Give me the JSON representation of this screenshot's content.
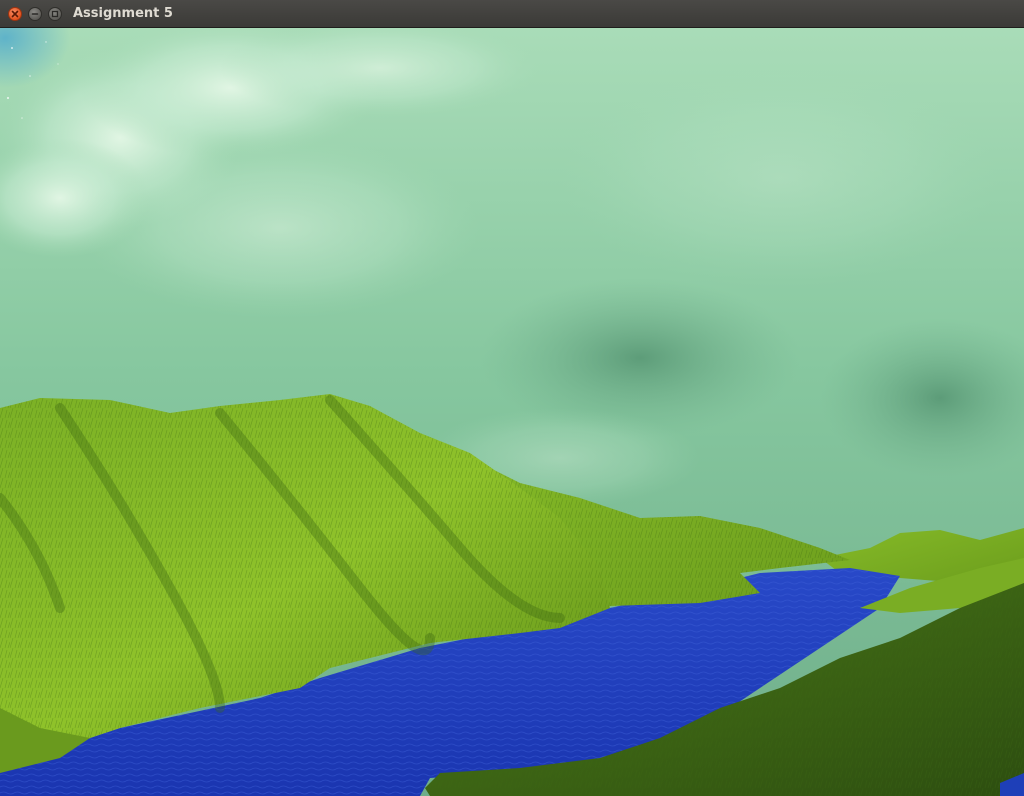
{
  "window": {
    "title": "Assignment 5"
  },
  "titlebar_buttons": {
    "close_icon": "close-icon",
    "minimize_icon": "minimize-icon",
    "maximize_icon": "maximize-icon"
  },
  "scene": {
    "sky_color": "#7fbf96",
    "cloud_highlight": "#c9ecd0",
    "grass_light": "#8fc22a",
    "grass_dark": "#3d6a12",
    "water_color": "#1f3fc0"
  }
}
